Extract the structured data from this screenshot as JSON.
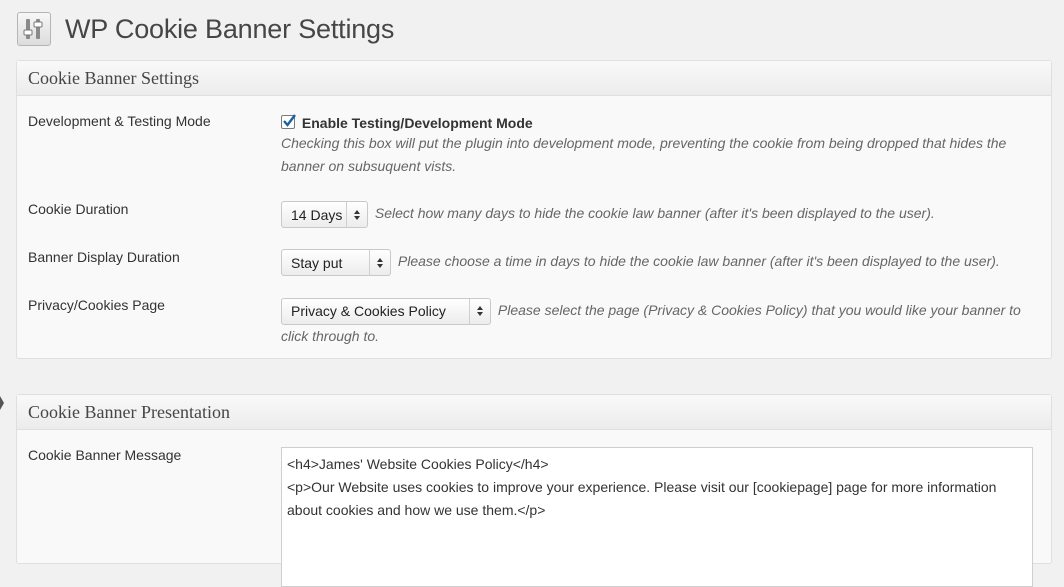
{
  "header": {
    "title": "WP Cookie Banner Settings",
    "icon": "settings-sliders-icon"
  },
  "settings_box": {
    "title": "Cookie Banner Settings",
    "dev_mode": {
      "label": "Development & Testing Mode",
      "checkbox_label": "Enable Testing/Development Mode",
      "checked": true,
      "description_line1": "Checking this box will put the plugin into development mode, preventing the cookie from being dropped that hides the",
      "description_line2": "banner on subsuquent vists."
    },
    "cookie_duration": {
      "label": "Cookie Duration",
      "value": "14 Days",
      "description": "Select how many days to hide the cookie law banner (after it's been displayed to the user)."
    },
    "banner_display": {
      "label": "Banner Display Duration",
      "value": "Stay put",
      "description": "Please choose a time in days to hide the cookie law banner (after it's been displayed to the user)."
    },
    "privacy_page": {
      "label": "Privacy/Cookies Page",
      "value": "Privacy & Cookies Policy",
      "description_line1": "Please select the page (Privacy & Cookies Policy) that you would like your banner to",
      "description_line2": "click through to."
    }
  },
  "presentation_box": {
    "title": "Cookie Banner Presentation",
    "message": {
      "label": "Cookie Banner Message",
      "line1": "<h4>James' Website Cookies Policy</h4>",
      "line2": "<p>Our Website uses cookies to improve your experience.  Please visit our [cookiepage] page for more information",
      "line3": "about cookies and how we use them.</p>"
    }
  },
  "colors": {
    "background": "#f1f1f1",
    "box": "#f9f9f9",
    "border": "#dfdfdf",
    "description": "#666666"
  }
}
